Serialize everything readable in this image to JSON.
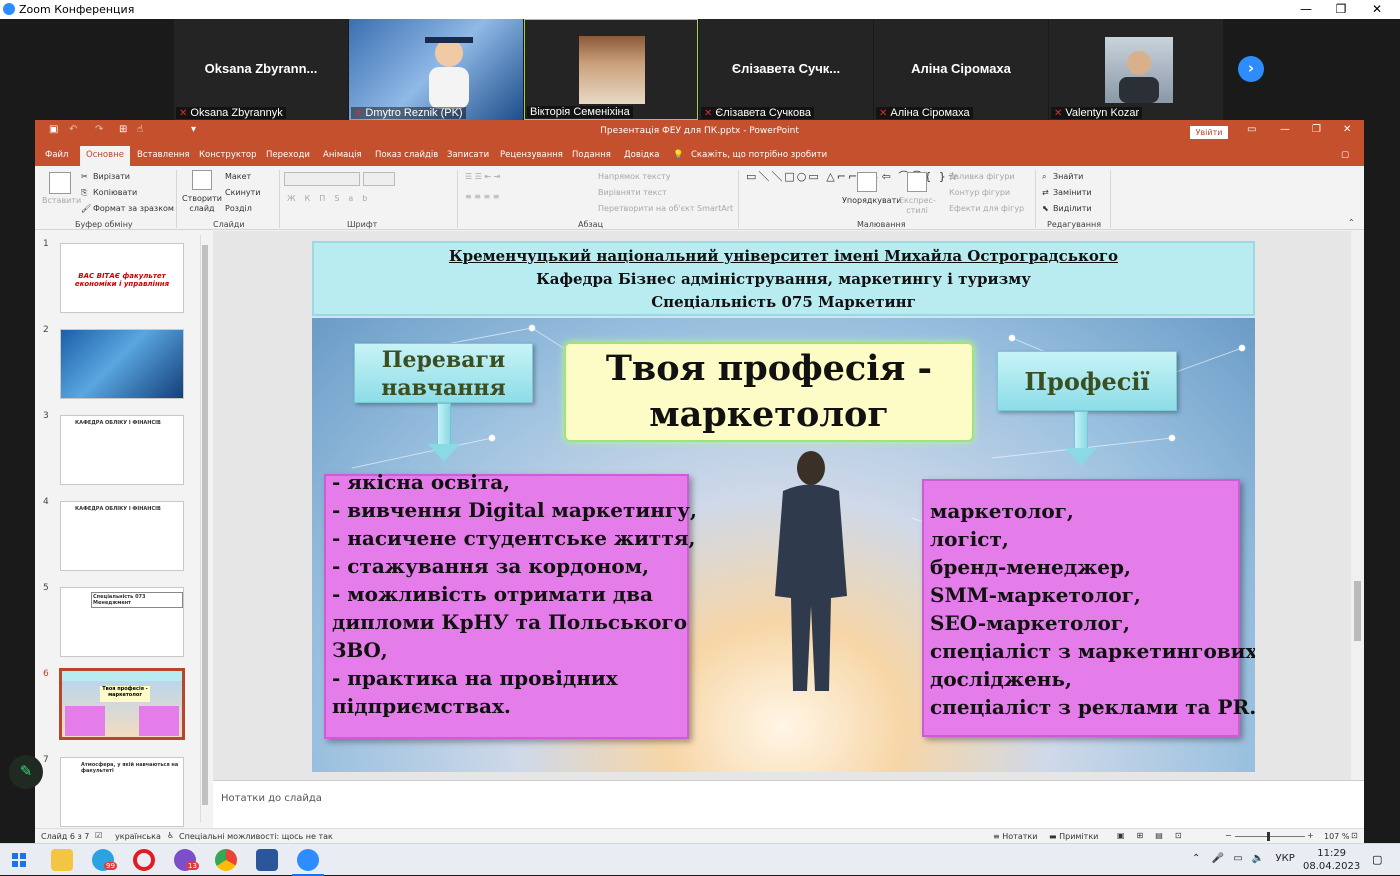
{
  "zoom": {
    "title": "Zoom Конференция",
    "window_buttons": [
      "—",
      "❐",
      "✕"
    ]
  },
  "participants": [
    {
      "display_name": "Oksana  Zbyrann...",
      "label": "Oksana Zbyrannyk",
      "video": false
    },
    {
      "display_name": "",
      "label": "Dmytro Reznik (PK)",
      "video": true
    },
    {
      "display_name": "",
      "label": "Вікторія Семеніхіна",
      "video": true
    },
    {
      "display_name": "Єлізавета  Сучк...",
      "label": "Єлізавета Сучкова",
      "video": false
    },
    {
      "display_name": "Аліна Сіромаха",
      "label": "Аліна Сіромаха",
      "video": false
    },
    {
      "display_name": "",
      "label": "Valentyn Kozar",
      "video": true
    }
  ],
  "next_icon": "›",
  "powerpoint": {
    "doc_title": "Презентація ФЕУ для ПК.pptx  -  PowerPoint",
    "sign_in": "Увійти",
    "tabs": [
      "Файл",
      "Основне",
      "Вставлення",
      "Конструктор",
      "Переходи",
      "Анімація",
      "Показ слайдів",
      "Записати",
      "Рецензування",
      "Подання",
      "Довідка"
    ],
    "active_tab": "Основне",
    "tell_me": "Скажіть, що потрібно зробити",
    "ribbon": {
      "clipboard": {
        "paste": "Вставити",
        "cut": "Вирізати",
        "copy": "Копіювати",
        "format_painter": "Формат за зразком",
        "label": "Буфер обміну"
      },
      "slides": {
        "new_slide": "Створити слайд",
        "layout": "Макет",
        "reset": "Скинути",
        "section": "Розділ",
        "label": "Слайди"
      },
      "font": {
        "label": "Шрифт"
      },
      "paragraph": {
        "text_direction": "Напрямок тексту",
        "align_text": "Вирівняти текст",
        "smartart": "Перетворити на об'єкт SmartArt",
        "label": "Абзац"
      },
      "drawing": {
        "arrange": "Упорядкувати",
        "quick_styles": "Експрес-стилі",
        "fill": "Заливка фігури",
        "outline": "Контур фігури",
        "effects": "Ефекти для фігур",
        "label": "Малювання"
      },
      "editing": {
        "find": "Знайти",
        "replace": "Замінити",
        "select": "Виділити",
        "label": "Редагування"
      }
    },
    "thumbnails": [
      {
        "num": "1",
        "title": "ВАС ВІТАЄ факультет економіки і управління"
      },
      {
        "num": "2",
        "title": ""
      },
      {
        "num": "3",
        "title": "КАФЕДРА ОБЛІКУ І ФІНАНСІВ"
      },
      {
        "num": "4",
        "title": "КАФЕДРА ОБЛІКУ І ФІНАНСІВ"
      },
      {
        "num": "5",
        "title": "Спеціальність 073 Менеджмент"
      },
      {
        "num": "6",
        "title": "Твоя професія - маркетолог"
      },
      {
        "num": "7",
        "title": "Атмосфера, у якій навчаються на факультеті"
      }
    ],
    "selected_slide": "6",
    "notes_placeholder": "Нотатки до слайда",
    "status": {
      "slide_of": "Слайд 6 з 7",
      "language": "українська",
      "accessibility": "Спеціальні можливості: щось не так",
      "notes": "Нотатки",
      "comments": "Примітки",
      "zoom": "107 %"
    }
  },
  "slide": {
    "header": [
      "Кременчуцький національний університет імені Михайла Остроградського",
      "Кафедра Бізнес адміністрування, маркетингу і туризму",
      "Спеціальність 075 Маркетинг"
    ],
    "left_button": [
      "Переваги",
      "навчання"
    ],
    "banner": [
      "Твоя професія -",
      "маркетолог"
    ],
    "right_button": "Професії",
    "advantages": [
      "-   якісна освіта,",
      "-   вивчення Digital маркетингу,",
      "- насичене студентське життя,",
      "-   стажування за кордоном,",
      "-   можливість отримати два",
      "     дипломи КрНУ та Польського",
      "     ЗВО,",
      "-   практика на провідних",
      "     підприємствах."
    ],
    "professions": [
      "маркетолог,",
      "логіст,",
      "бренд-менеджер,",
      "SMM-маркетолог,",
      "SEO-маркетолог,",
      "спеціаліст з маркетингових",
      "досліджень,",
      "спеціаліст з реклами та PR."
    ]
  },
  "taskbar": {
    "language": "УКР",
    "time": "11:29",
    "date": "08.04.2023",
    "badges": {
      "telegram": "99",
      "viber": "13"
    }
  }
}
